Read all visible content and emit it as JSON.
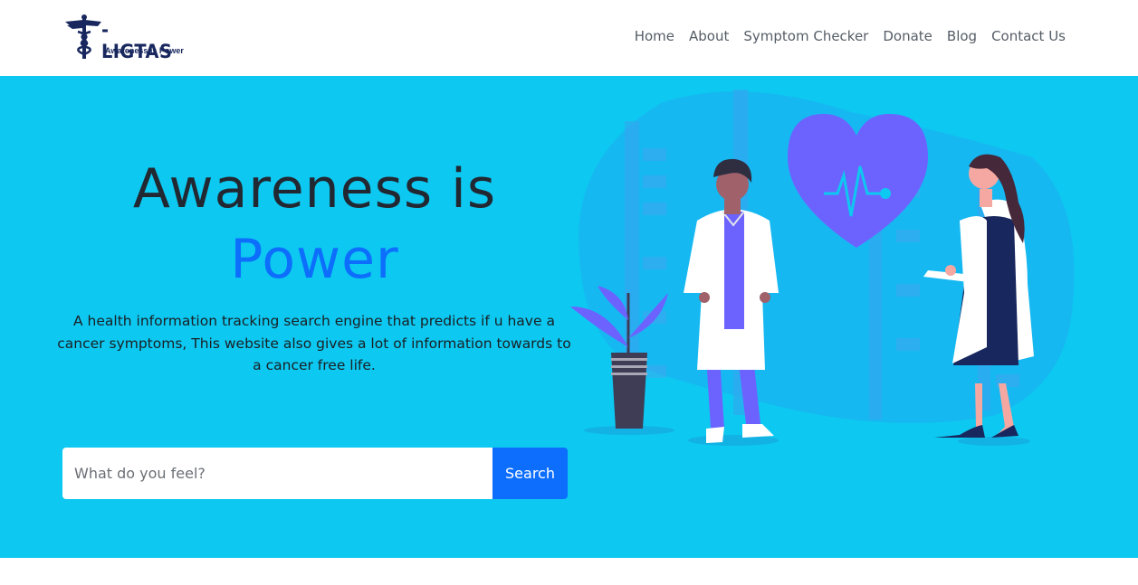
{
  "brand": {
    "name": "-LIGTAS",
    "tagline": "Awareness is Power"
  },
  "nav": {
    "items": [
      {
        "label": "Home"
      },
      {
        "label": "About"
      },
      {
        "label": "Symptom Checker"
      },
      {
        "label": "Donate"
      },
      {
        "label": "Blog"
      },
      {
        "label": "Contact Us"
      }
    ]
  },
  "hero": {
    "title_line1": "Awareness is",
    "title_line2": "Power",
    "description": "A health information tracking search engine that predicts if u have a cancer symptoms, This website also gives a lot of information towards to a cancer free life.",
    "search": {
      "placeholder": "What do you feel?",
      "value": "",
      "button_label": "Search"
    }
  },
  "colors": {
    "hero_background": "#0dc8f0",
    "accent": "#0d6efd",
    "title_text": "#222831",
    "nav_text": "#555d66",
    "logo": "#18275e",
    "heart": "#6c63ff"
  },
  "icons": {
    "logo_emblem": "caduceus-icon",
    "illustration": "doctors-with-heart-illustration"
  }
}
